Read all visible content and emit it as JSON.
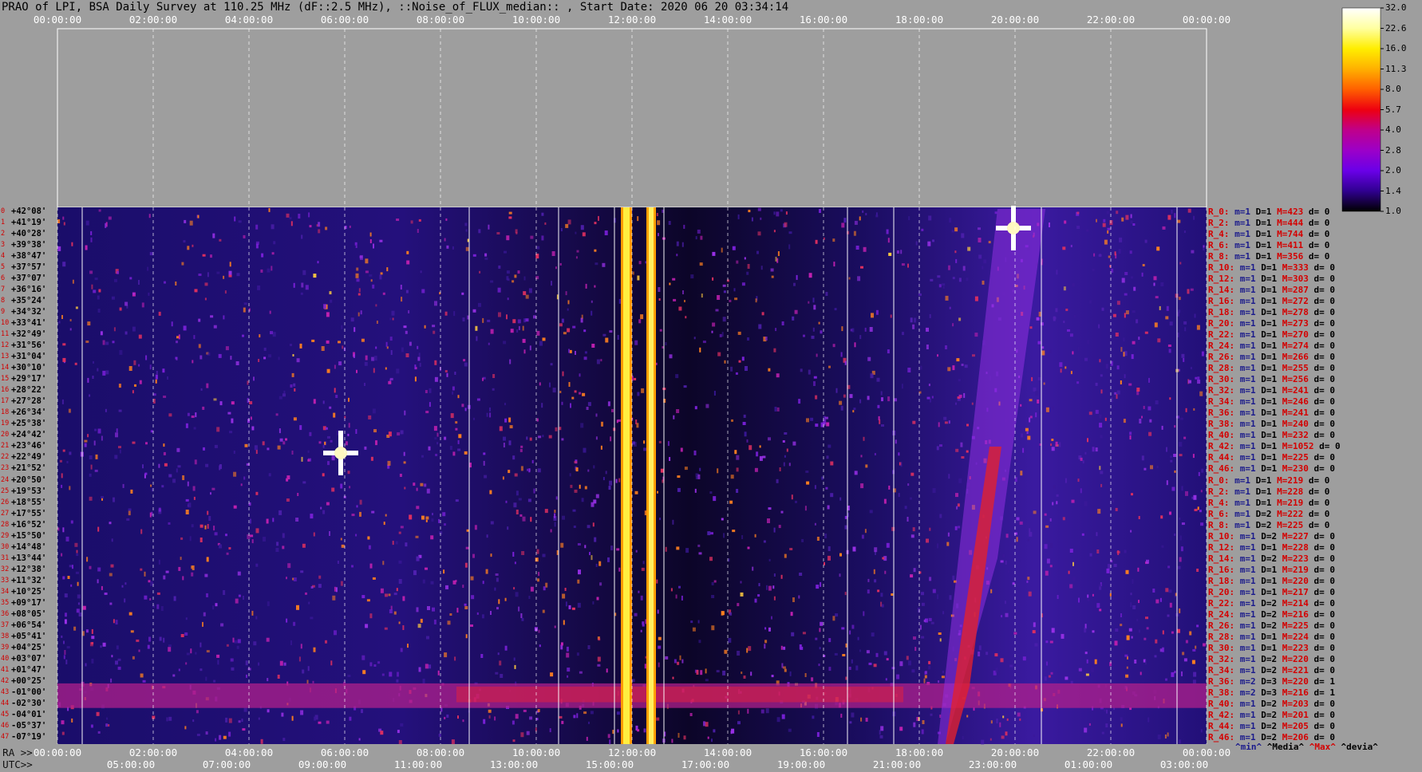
{
  "title": "PRAO of LPI, BSA Daily Survey at 110.25 MHz (dF::2.5 MHz), ::Noise_of_FLUX_median:: , Start Date: 2020 06 20 03:34:14",
  "chart_data": {
    "type": "heatmap",
    "title": "PRAO of LPI, BSA Daily Survey at 110.25 MHz (dF::2.5 MHz), ::Noise_of_FLUX_median:: , Start Date: 2020 06 20 03:34:14",
    "top_axis_ticks": [
      "00:00:00",
      "02:00:00",
      "04:00:00",
      "06:00:00",
      "08:00:00",
      "10:00:00",
      "12:00:00",
      "14:00:00",
      "16:00:00",
      "18:00:00",
      "20:00:00",
      "22:00:00",
      "00:00:00"
    ],
    "bottom_ra_prefix": "RA >>",
    "bottom_ra_ticks": [
      "00:00:00",
      "02:00:00",
      "04:00:00",
      "06:00:00",
      "08:00:00",
      "10:00:00",
      "12:00:00",
      "14:00:00",
      "16:00:00",
      "18:00:00",
      "20:00:00",
      "22:00:00",
      "00:00:00"
    ],
    "bottom_utc_prefix": "UTC>>",
    "bottom_utc_ticks": [
      "05:00:00",
      "07:00:00",
      "09:00:00",
      "11:00:00",
      "13:00:00",
      "15:00:00",
      "17:00:00",
      "19:00:00",
      "21:00:00",
      "23:00:00",
      "01:00:00",
      "03:00:00"
    ],
    "declination_labels": [
      "+42°08'",
      "+41°19'",
      "+40°28'",
      "+39°38'",
      "+38°47'",
      "+37°57'",
      "+37°07'",
      "+36°16'",
      "+35°24'",
      "+34°32'",
      "+33°41'",
      "+32°49'",
      "+31°56'",
      "+31°04'",
      "+30°10'",
      "+29°17'",
      "+28°22'",
      "+27°28'",
      "+26°34'",
      "+25°38'",
      "+24°42'",
      "+23°46'",
      "+22°49'",
      "+21°52'",
      "+20°50'",
      "+19°53'",
      "+18°55'",
      "+17°55'",
      "+16°52'",
      "+15°50'",
      "+14°48'",
      "+13°44'",
      "+12°38'",
      "+11°32'",
      "+10°25'",
      "+09°17'",
      "+08°05'",
      "+06°54'",
      "+05°41'",
      "+04°25'",
      "+03°07'",
      "+01°47'",
      "+00°25'",
      "-01°00'",
      "-02°30'",
      "-04°01'",
      "-05°37'",
      "-07°19'"
    ],
    "row_stats": [
      {
        "r": "R_0:",
        "m": "m=1",
        "d": "D=1",
        "M": "M=423",
        "dv": "d= 0"
      },
      {
        "r": "R_2:",
        "m": "m=1",
        "d": "D=1",
        "M": "M=444",
        "dv": "d= 0"
      },
      {
        "r": "R_4:",
        "m": "m=1",
        "d": "D=1",
        "M": "M=744",
        "dv": "d= 0"
      },
      {
        "r": "R_6:",
        "m": "m=1",
        "d": "D=1",
        "M": "M=411",
        "dv": "d= 0"
      },
      {
        "r": "R_8:",
        "m": "m=1",
        "d": "D=1",
        "M": "M=356",
        "dv": "d= 0"
      },
      {
        "r": "R_10:",
        "m": "m=1",
        "d": "D=1",
        "M": "M=333",
        "dv": "d= 0"
      },
      {
        "r": "R_12:",
        "m": "m=1",
        "d": "D=1",
        "M": "M=303",
        "dv": "d= 0"
      },
      {
        "r": "R_14:",
        "m": "m=1",
        "d": "D=1",
        "M": "M=287",
        "dv": "d= 0"
      },
      {
        "r": "R_16:",
        "m": "m=1",
        "d": "D=1",
        "M": "M=272",
        "dv": "d= 0"
      },
      {
        "r": "R_18:",
        "m": "m=1",
        "d": "D=1",
        "M": "M=278",
        "dv": "d= 0"
      },
      {
        "r": "R_20:",
        "m": "m=1",
        "d": "D=1",
        "M": "M=273",
        "dv": "d= 0"
      },
      {
        "r": "R_22:",
        "m": "m=1",
        "d": "D=1",
        "M": "M=270",
        "dv": "d= 0"
      },
      {
        "r": "R_24:",
        "m": "m=1",
        "d": "D=1",
        "M": "M=274",
        "dv": "d= 0"
      },
      {
        "r": "R_26:",
        "m": "m=1",
        "d": "D=1",
        "M": "M=266",
        "dv": "d= 0"
      },
      {
        "r": "R_28:",
        "m": "m=1",
        "d": "D=1",
        "M": "M=255",
        "dv": "d= 0"
      },
      {
        "r": "R_30:",
        "m": "m=1",
        "d": "D=1",
        "M": "M=256",
        "dv": "d= 0"
      },
      {
        "r": "R_32:",
        "m": "m=1",
        "d": "D=1",
        "M": "M=241",
        "dv": "d= 0"
      },
      {
        "r": "R_34:",
        "m": "m=1",
        "d": "D=1",
        "M": "M=246",
        "dv": "d= 0"
      },
      {
        "r": "R_36:",
        "m": "m=1",
        "d": "D=1",
        "M": "M=241",
        "dv": "d= 0"
      },
      {
        "r": "R_38:",
        "m": "m=1",
        "d": "D=1",
        "M": "M=240",
        "dv": "d= 0"
      },
      {
        "r": "R_40:",
        "m": "m=1",
        "d": "D=1",
        "M": "M=232",
        "dv": "d= 0"
      },
      {
        "r": "R_42:",
        "m": "m=1",
        "d": "D=1",
        "M": "M=1052",
        "dv": "d= 0"
      },
      {
        "r": "R_44:",
        "m": "m=1",
        "d": "D=1",
        "M": "M=225",
        "dv": "d= 0"
      },
      {
        "r": "R_46:",
        "m": "m=1",
        "d": "D=1",
        "M": "M=230",
        "dv": "d= 0"
      },
      {
        "r": "R_0:",
        "m": "m=1",
        "d": "D=1",
        "M": "M=219",
        "dv": "d= 0"
      },
      {
        "r": "R_2:",
        "m": "m=1",
        "d": "D=1",
        "M": "M=228",
        "dv": "d= 0"
      },
      {
        "r": "R_4:",
        "m": "m=1",
        "d": "D=1",
        "M": "M=219",
        "dv": "d= 0"
      },
      {
        "r": "R_6:",
        "m": "m=1",
        "d": "D=2",
        "M": "M=222",
        "dv": "d= 0"
      },
      {
        "r": "R_8:",
        "m": "m=1",
        "d": "D=2",
        "M": "M=225",
        "dv": "d= 0"
      },
      {
        "r": "R_10:",
        "m": "m=1",
        "d": "D=2",
        "M": "M=227",
        "dv": "d= 0"
      },
      {
        "r": "R_12:",
        "m": "m=1",
        "d": "D=1",
        "M": "M=228",
        "dv": "d= 0"
      },
      {
        "r": "R_14:",
        "m": "m=1",
        "d": "D=2",
        "M": "M=223",
        "dv": "d= 0"
      },
      {
        "r": "R_16:",
        "m": "m=1",
        "d": "D=1",
        "M": "M=219",
        "dv": "d= 0"
      },
      {
        "r": "R_18:",
        "m": "m=1",
        "d": "D=1",
        "M": "M=220",
        "dv": "d= 0"
      },
      {
        "r": "R_20:",
        "m": "m=1",
        "d": "D=1",
        "M": "M=217",
        "dv": "d= 0"
      },
      {
        "r": "R_22:",
        "m": "m=1",
        "d": "D=2",
        "M": "M=214",
        "dv": "d= 0"
      },
      {
        "r": "R_24:",
        "m": "m=1",
        "d": "D=2",
        "M": "M=216",
        "dv": "d= 0"
      },
      {
        "r": "R_26:",
        "m": "m=1",
        "d": "D=2",
        "M": "M=225",
        "dv": "d= 0"
      },
      {
        "r": "R_28:",
        "m": "m=1",
        "d": "D=1",
        "M": "M=224",
        "dv": "d= 0"
      },
      {
        "r": "R_30:",
        "m": "m=1",
        "d": "D=1",
        "M": "M=223",
        "dv": "d= 0"
      },
      {
        "r": "R_32:",
        "m": "m=1",
        "d": "D=2",
        "M": "M=220",
        "dv": "d= 0"
      },
      {
        "r": "R_34:",
        "m": "m=1",
        "d": "D=2",
        "M": "M=221",
        "dv": "d= 0"
      },
      {
        "r": "R_36:",
        "m": "m=2",
        "d": "D=3",
        "M": "M=220",
        "dv": "d= 1"
      },
      {
        "r": "R_38:",
        "m": "m=2",
        "d": "D=3",
        "M": "M=216",
        "dv": "d= 1"
      },
      {
        "r": "R_40:",
        "m": "m=1",
        "d": "D=2",
        "M": "M=203",
        "dv": "d= 0"
      },
      {
        "r": "R_42:",
        "m": "m=1",
        "d": "D=2",
        "M": "M=201",
        "dv": "d= 0"
      },
      {
        "r": "R_44:",
        "m": "m=1",
        "d": "D=2",
        "M": "M=205",
        "dv": "d= 0"
      },
      {
        "r": "R_46:",
        "m": "m=1",
        "d": "D=2",
        "M": "M=206",
        "dv": "d= 0"
      }
    ],
    "stat_legend": {
      "min": "^min^",
      "median": "^Media^",
      "max": "^Max^",
      "devia": "^devia^"
    },
    "colorbar": {
      "ticks": [
        "32.0",
        "22.6",
        "16.0",
        "11.3",
        "8.0",
        "5.7",
        "4.0",
        "2.8",
        "2.0",
        "1.4",
        "1.0"
      ],
      "colors": [
        "#ffffff",
        "#ffffa0",
        "#ffee00",
        "#ffb000",
        "#ff6000",
        "#ee0010",
        "#c0008a",
        "#9c00c8",
        "#6a00e8",
        "#300090",
        "#000000"
      ]
    }
  }
}
